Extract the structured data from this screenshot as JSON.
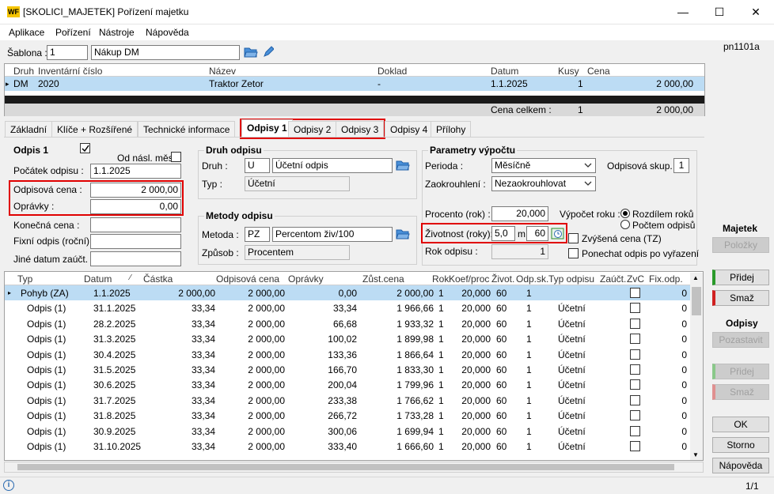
{
  "window": {
    "title": "[SKOLICI_MAJETEK] Pořízení majetku",
    "minimize": "—",
    "maximize": "☐",
    "close": "✕",
    "logo": "WF"
  },
  "menu": [
    "Aplikace",
    "Pořízení",
    "Nástroje",
    "Nápověda"
  ],
  "form_code": "pn1101a",
  "sablona": {
    "label": "Šablona :",
    "code": "1",
    "name": "Nákup DM"
  },
  "grid1": {
    "headers": [
      "Druh",
      "Inventární číslo",
      "Název",
      "Doklad",
      "Datum",
      "Kusy",
      "Cena"
    ],
    "row": {
      "marker": "▸",
      "druh": "DM",
      "inv": "2020",
      "nazev": "Traktor Zetor",
      "doklad": "-",
      "datum": "1.1.2025",
      "kusy": "1",
      "cena": "2 000,00"
    },
    "total": {
      "label": "Cena celkem :",
      "kusy": "1",
      "cena": "2 000,00"
    }
  },
  "tabs": [
    "Základní",
    "Klíče + Rozšířené",
    "Technické informace",
    "Odpisy 1",
    "Odpisy 2",
    "Odpisy 3",
    "Odpisy 4",
    "Přílohy"
  ],
  "odpis1": {
    "title": "Odpis 1",
    "od_nasl": "Od násl. měs.",
    "pocatek_label": "Počátek odpisu :",
    "pocatek": "1.1.2025",
    "odp_cena_label": "Odpisová cena :",
    "odp_cena": "2 000,00",
    "opravky_label": "Oprávky :",
    "opravky": "0,00",
    "konecna_label": "Konečná cena :",
    "fixni_label": "Fixní odpis (roční) :",
    "jine_label": "Jiné datum zaúčt. :"
  },
  "druh": {
    "title": "Druh odpisu",
    "druh_label": "Druh :",
    "druh_code": "U",
    "druh_name": "Účetní odpis",
    "typ_label": "Typ :",
    "typ": "Účetní"
  },
  "metody": {
    "title": "Metody odpisu",
    "metoda_label": "Metoda :",
    "metoda_code": "PZ",
    "metoda_name": "Percentom živ/100",
    "zpusob_label": "Způsob :",
    "zpusob": "Procentem"
  },
  "param": {
    "title": "Parametry výpočtu",
    "perioda_label": "Perioda :",
    "perioda": "Měsíčně",
    "zaokr_label": "Zaokrouhlení :",
    "zaokr": "Nezaokrouhlovat",
    "odpskup_label": "Odpisová skup. :",
    "odpskup": "1",
    "procento_label": "Procento (rok) :",
    "procento": "20,000",
    "vypocet_label": "Výpočet roku :",
    "radio1": "Rozdílem roků",
    "radio2": "Počtem odpisů",
    "zivotnost_label": "Životnost (roky):",
    "zivotnost": "5,0",
    "m_label": "m",
    "mesice": "60",
    "zvysena": "Zvýšená cena (TZ)",
    "ponechat": "Ponechat odpis po vyřazení",
    "rok_label": "Rok odpisu :",
    "rok": "1"
  },
  "grid2": {
    "headers": [
      "Typ",
      "Datum",
      "Částka",
      "Odpisová cena",
      "Oprávky",
      "Zůst.cena",
      "Rok",
      "Koef/proc",
      "Život.",
      "Odp.sk.",
      "Typ odpisu",
      "Zaúčt.",
      "ZvC",
      "Fix.odp."
    ],
    "rows": [
      {
        "typ": "Pohyb (ZA)",
        "datum": "1.1.2025",
        "castka": "2 000,00",
        "odpcena": "2 000,00",
        "opravky": "0,00",
        "zust": "2 000,00",
        "rok": "1",
        "koef": "20,000",
        "ziv": "60",
        "odpsk": "1",
        "typodp": "",
        "fix": "0"
      },
      {
        "typ": "Odpis (1)",
        "datum": "31.1.2025",
        "castka": "33,34",
        "odpcena": "2 000,00",
        "opravky": "33,34",
        "zust": "1 966,66",
        "rok": "1",
        "koef": "20,000",
        "ziv": "60",
        "odpsk": "1",
        "typodp": "Účetní",
        "fix": "0"
      },
      {
        "typ": "Odpis (1)",
        "datum": "28.2.2025",
        "castka": "33,34",
        "odpcena": "2 000,00",
        "opravky": "66,68",
        "zust": "1 933,32",
        "rok": "1",
        "koef": "20,000",
        "ziv": "60",
        "odpsk": "1",
        "typodp": "Účetní",
        "fix": "0"
      },
      {
        "typ": "Odpis (1)",
        "datum": "31.3.2025",
        "castka": "33,34",
        "odpcena": "2 000,00",
        "opravky": "100,02",
        "zust": "1 899,98",
        "rok": "1",
        "koef": "20,000",
        "ziv": "60",
        "odpsk": "1",
        "typodp": "Účetní",
        "fix": "0"
      },
      {
        "typ": "Odpis (1)",
        "datum": "30.4.2025",
        "castka": "33,34",
        "odpcena": "2 000,00",
        "opravky": "133,36",
        "zust": "1 866,64",
        "rok": "1",
        "koef": "20,000",
        "ziv": "60",
        "odpsk": "1",
        "typodp": "Účetní",
        "fix": "0"
      },
      {
        "typ": "Odpis (1)",
        "datum": "31.5.2025",
        "castka": "33,34",
        "odpcena": "2 000,00",
        "opravky": "166,70",
        "zust": "1 833,30",
        "rok": "1",
        "koef": "20,000",
        "ziv": "60",
        "odpsk": "1",
        "typodp": "Účetní",
        "fix": "0"
      },
      {
        "typ": "Odpis (1)",
        "datum": "30.6.2025",
        "castka": "33,34",
        "odpcena": "2 000,00",
        "opravky": "200,04",
        "zust": "1 799,96",
        "rok": "1",
        "koef": "20,000",
        "ziv": "60",
        "odpsk": "1",
        "typodp": "Účetní",
        "fix": "0"
      },
      {
        "typ": "Odpis (1)",
        "datum": "31.7.2025",
        "castka": "33,34",
        "odpcena": "2 000,00",
        "opravky": "233,38",
        "zust": "1 766,62",
        "rok": "1",
        "koef": "20,000",
        "ziv": "60",
        "odpsk": "1",
        "typodp": "Účetní",
        "fix": "0"
      },
      {
        "typ": "Odpis (1)",
        "datum": "31.8.2025",
        "castka": "33,34",
        "odpcena": "2 000,00",
        "opravky": "266,72",
        "zust": "1 733,28",
        "rok": "1",
        "koef": "20,000",
        "ziv": "60",
        "odpsk": "1",
        "typodp": "Účetní",
        "fix": "0"
      },
      {
        "typ": "Odpis (1)",
        "datum": "30.9.2025",
        "castka": "33,34",
        "odpcena": "2 000,00",
        "opravky": "300,06",
        "zust": "1 699,94",
        "rok": "1",
        "koef": "20,000",
        "ziv": "60",
        "odpsk": "1",
        "typodp": "Účetní",
        "fix": "0"
      },
      {
        "typ": "Odpis (1)",
        "datum": "31.10.2025",
        "castka": "33,34",
        "odpcena": "2 000,00",
        "opravky": "333,40",
        "zust": "1 666,60",
        "rok": "1",
        "koef": "20,000",
        "ziv": "60",
        "odpsk": "1",
        "typodp": "Účetní",
        "fix": "0"
      }
    ]
  },
  "sidebar": {
    "majetek": "Majetek",
    "polozky": "Položky",
    "pridej1": "Přidej",
    "smaz1": "Smaž",
    "odpisy": "Odpisy",
    "pozastavit": "Pozastavit",
    "pridej2": "Přidej",
    "smaz2": "Smaž",
    "ok": "OK",
    "storno": "Storno",
    "napoveda": "Nápověda"
  },
  "status": {
    "page": "1/1"
  }
}
